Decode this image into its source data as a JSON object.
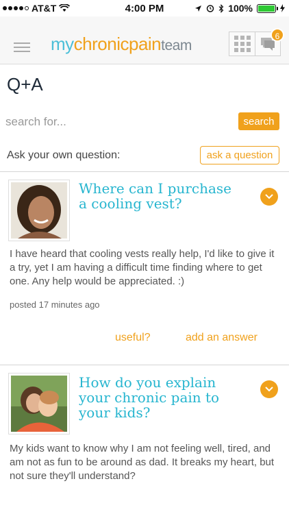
{
  "status_bar": {
    "carrier": "AT&T",
    "time": "4:00 PM",
    "battery": "100%"
  },
  "header": {
    "logo_my": "my",
    "logo_chronicpain": "chronicpain",
    "logo_team": "team",
    "notification_count": "6"
  },
  "page": {
    "title": "Q+A"
  },
  "search": {
    "placeholder": "search for...",
    "button_label": "search"
  },
  "ask": {
    "label": "Ask your own question:",
    "button_label": "ask a question"
  },
  "questions": [
    {
      "title": "Where can I purchase a cooling vest?",
      "body": "I have heard that cooling vests really help, I'd like to give it a try, yet I am having a difficult time finding where to get one.  Any help would be appreciated. :)",
      "posted": "posted 17 minutes ago",
      "useful_label": "useful?",
      "answer_label": "add an answer"
    },
    {
      "title": "How do you explain your chronic pain to your kids?",
      "body": "My kids want to know why I am not feeling well, tired, and am not as fun to be around as dad.  It breaks my heart, but not sure they'll understand?"
    }
  ],
  "colors": {
    "accent_orange": "#f0a11c",
    "title_teal": "#26b5cf",
    "logo_blue": "#4bbfd8"
  }
}
